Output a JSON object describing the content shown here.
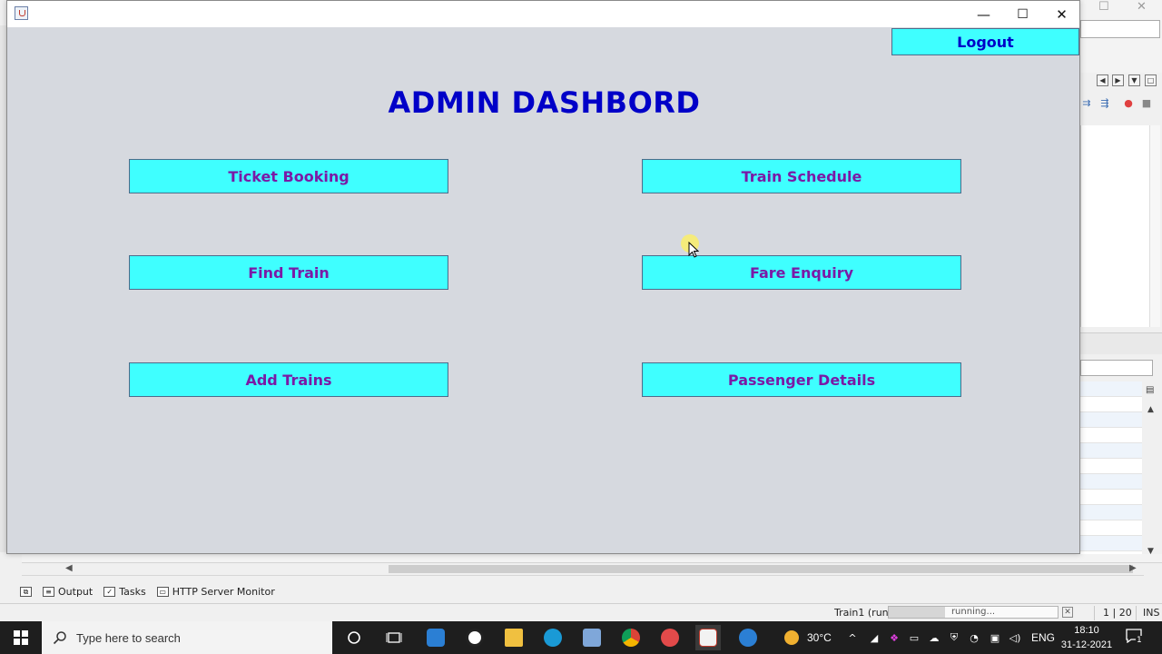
{
  "app": {
    "title": "ADMIN DASHBORD",
    "logout_label": "Logout",
    "buttons": {
      "ticket_booking": "Ticket Booking",
      "train_schedule": "Train Schedule",
      "find_train": "Find Train",
      "fare_enquiry": "Fare Enquiry",
      "add_trains": "Add Trains",
      "passenger_details": "Passenger Details"
    },
    "window_controls": {
      "minimize": "—",
      "maximize": "☐",
      "close": "✕"
    }
  },
  "ide": {
    "bottom_tabs": [
      "Output",
      "Tasks",
      "HTTP Server Monitor"
    ],
    "status": {
      "project": "Train1 (run)",
      "progress_text": "running...",
      "position": "1 | 20",
      "mode": "INS"
    }
  },
  "taskbar": {
    "search_placeholder": "Type here to search",
    "temperature": "30°C",
    "language": "ENG",
    "time": "18:10",
    "date": "31-12-2021",
    "notification_count": "1"
  },
  "colors": {
    "button_bg": "#3fffff",
    "title_color": "#0000c8",
    "button_text": "#7a1aa6",
    "window_bg": "#d6d9df"
  }
}
